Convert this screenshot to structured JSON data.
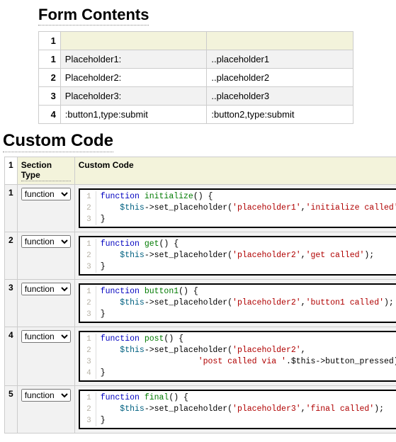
{
  "headings": {
    "form_contents": "Form Contents",
    "custom_code": "Custom Code"
  },
  "form_contents": {
    "header_rownum": "1",
    "rows": [
      {
        "num": "1",
        "a": "Placeholder1:",
        "b": "..placeholder1"
      },
      {
        "num": "2",
        "a": "Placeholder2:",
        "b": "..placeholder2"
      },
      {
        "num": "3",
        "a": "Placeholder3:",
        "b": "..placeholder3"
      },
      {
        "num": "4",
        "a": ":button1,type:submit",
        "b": ":button2,type:submit"
      }
    ]
  },
  "custom_code": {
    "header_rownum": "1",
    "col_section": "Section Type",
    "col_code": "Custom Code",
    "select_value": "function",
    "rows": [
      {
        "num": "1",
        "fn_name": "initialize",
        "args": [
          "placeholder1",
          "initialize called"
        ],
        "extra": null
      },
      {
        "num": "2",
        "fn_name": "get",
        "args": [
          "placeholder2",
          "get called"
        ],
        "extra": null
      },
      {
        "num": "3",
        "fn_name": "button1",
        "args": [
          "placeholder2",
          "button1 called"
        ],
        "extra": null
      },
      {
        "num": "4",
        "fn_name": "post",
        "args_first": "placeholder2",
        "wrap_str": "post called via ",
        "wrap_tail": ".$this->button_pressed);",
        "extra": "wrap"
      },
      {
        "num": "5",
        "fn_name": "final",
        "args": [
          "placeholder3",
          "final called"
        ],
        "extra": null
      }
    ]
  }
}
